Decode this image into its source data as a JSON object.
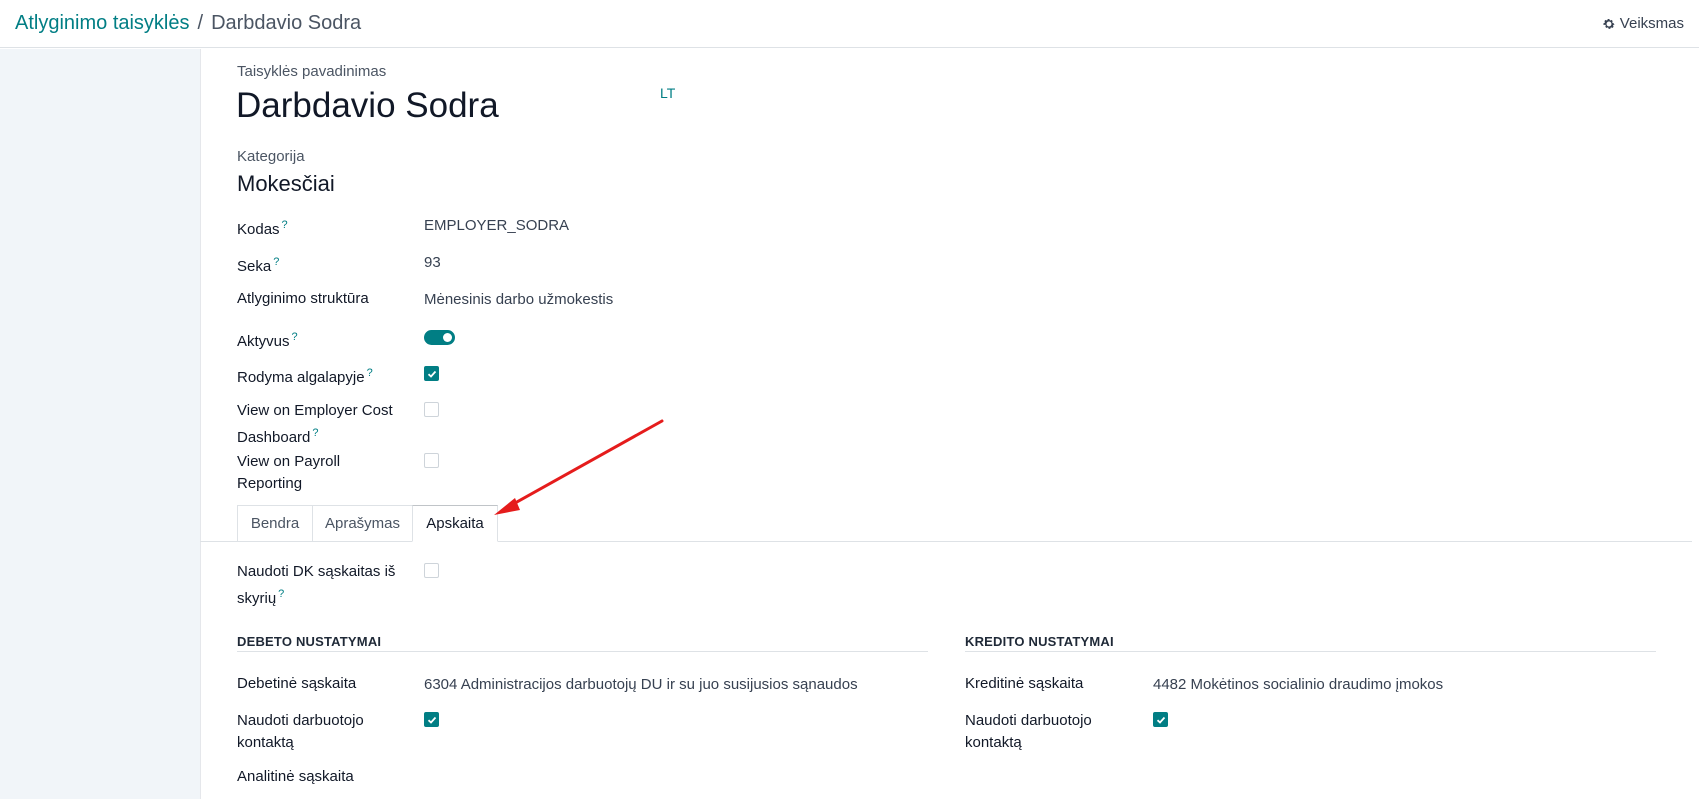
{
  "breadcrumb": {
    "parent": "Atlyginimo taisyklės",
    "separator": "/",
    "current": "Darbdavio Sodra"
  },
  "actions": {
    "label": "Veiksmas",
    "icon": "gear-icon"
  },
  "form": {
    "name_label": "Taisyklės pavadinimas",
    "name_value": "Darbdavio Sodra",
    "lang_button": "LT",
    "category_label": "Kategorija",
    "category_value": "Mokesčiai",
    "code_label": "Kodas",
    "code_value": "EMPLOYER_SODRA",
    "sequence_label": "Seka",
    "sequence_value": "93",
    "structure_label": "Atlyginimo struktūra",
    "structure_value": "Mėnesinis darbo užmokestis",
    "active_label": "Aktyvus",
    "active_value": true,
    "payslip_label": "Rodyma algalapyje",
    "payslip_value": true,
    "employer_cost_label_1": "View on Employer Cost",
    "employer_cost_label_2": "Dashboard",
    "employer_cost_value": false,
    "payroll_reporting_label_1": "View on Payroll",
    "payroll_reporting_label_2": "Reporting",
    "payroll_reporting_value": false,
    "help_mark": "?"
  },
  "tabs": [
    {
      "label": "Bendra",
      "active": false
    },
    {
      "label": "Aprašymas",
      "active": false
    },
    {
      "label": "Apskaita",
      "active": true
    }
  ],
  "accounting": {
    "use_dk_label_1": "Naudoti DK sąskaitas iš",
    "use_dk_label_2": "skyrių",
    "use_dk_value": false,
    "debit": {
      "header": "DEBETO NUSTATYMAI",
      "account_label": "Debetinė sąskaita",
      "account_value": "6304 Administracijos darbuotojų DU ir su juo susijusios sąnaudos",
      "partner_label_1": "Naudoti darbuotojo",
      "partner_label_2": "kontaktą",
      "partner_value": true,
      "analytic_label": "Analitinė sąskaita"
    },
    "credit": {
      "header": "KREDITO NUSTATYMAI",
      "account_label": "Kreditinė sąskaita",
      "account_value": "4482 Mokėtinos socialinio draudimo įmokos",
      "partner_label_1": "Naudoti darbuotojo",
      "partner_label_2": "kontaktą",
      "partner_value": true
    }
  },
  "colors": {
    "accent": "#017e84",
    "arrow": "#e51c1c"
  }
}
